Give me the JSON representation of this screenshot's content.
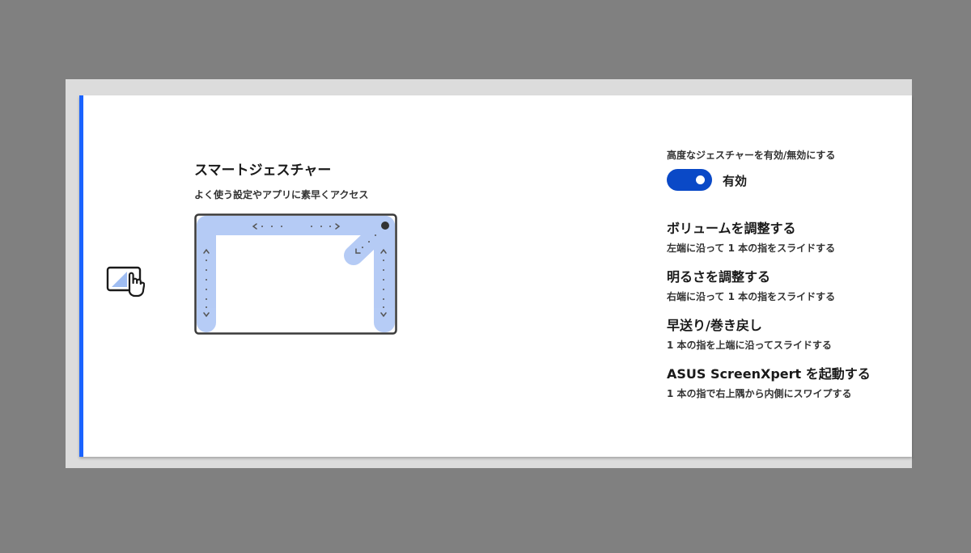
{
  "feature": {
    "title": "スマートジェスチャー",
    "subtitle": "よく使う設定やアプリに素早くアクセス",
    "icon": "touchpad-gesture-icon"
  },
  "toggle": {
    "label": "高度なジェスチャーを有効/無効にする",
    "state_label": "有効",
    "enabled": true,
    "color": "#0a49c7"
  },
  "gestures": [
    {
      "title": "ボリュームを調整する",
      "description": "左端に沿って 1 本の指をスライドする"
    },
    {
      "title": "明るさを調整する",
      "description": "右端に沿って 1 本の指をスライドする"
    },
    {
      "title": "早送り/巻き戻し",
      "description": "1 本の指を上端に沿ってスライドする"
    },
    {
      "title": "ASUS ScreenXpert を起動する",
      "description": "1 本の指で右上隅から内側にスワイプする"
    }
  ],
  "colors": {
    "accent": "#1a63ff",
    "highlight": "#aec6f5",
    "background": "#808080"
  }
}
